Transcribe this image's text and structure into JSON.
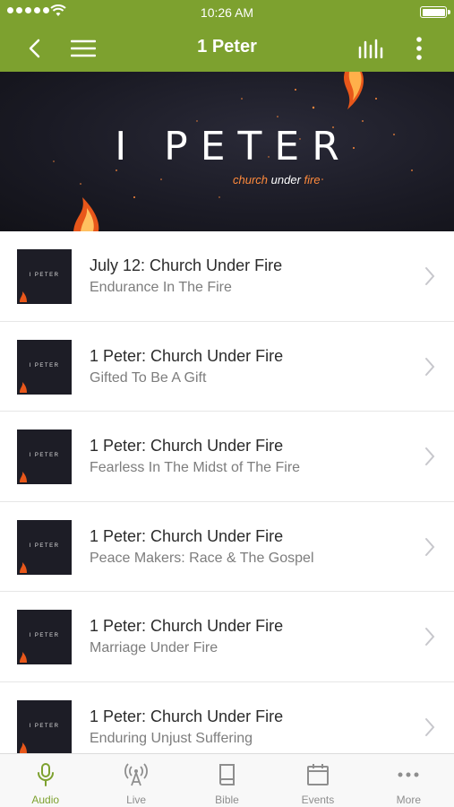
{
  "status_bar": {
    "time": "10:26 AM"
  },
  "nav": {
    "title": "1 Peter"
  },
  "hero": {
    "title": "I PETER",
    "subtitle_church": "church",
    "subtitle_under": "under",
    "subtitle_fire": "fire"
  },
  "thumb_text": "I PETER",
  "items": [
    {
      "title": "July 12: Church Under Fire",
      "subtitle": "Endurance In The Fire"
    },
    {
      "title": "1 Peter: Church Under Fire",
      "subtitle": "Gifted To Be A Gift"
    },
    {
      "title": "1 Peter: Church Under Fire",
      "subtitle": "Fearless In The Midst of The Fire"
    },
    {
      "title": "1 Peter: Church Under Fire",
      "subtitle": "Peace Makers: Race & The Gospel"
    },
    {
      "title": "1 Peter: Church Under Fire",
      "subtitle": "Marriage Under Fire"
    },
    {
      "title": "1 Peter: Church Under Fire",
      "subtitle": "Enduring Unjust Suffering"
    }
  ],
  "tabs": [
    {
      "label": "Audio",
      "icon": "microphone-icon"
    },
    {
      "label": "Live",
      "icon": "broadcast-icon"
    },
    {
      "label": "Bible",
      "icon": "book-icon"
    },
    {
      "label": "Events",
      "icon": "calendar-icon"
    },
    {
      "label": "More",
      "icon": "more-dots-icon"
    }
  ],
  "colors": {
    "brand": "#7da12f",
    "inactive_tab": "#8e8e8e",
    "accent_fire": "#ff8a3c"
  }
}
